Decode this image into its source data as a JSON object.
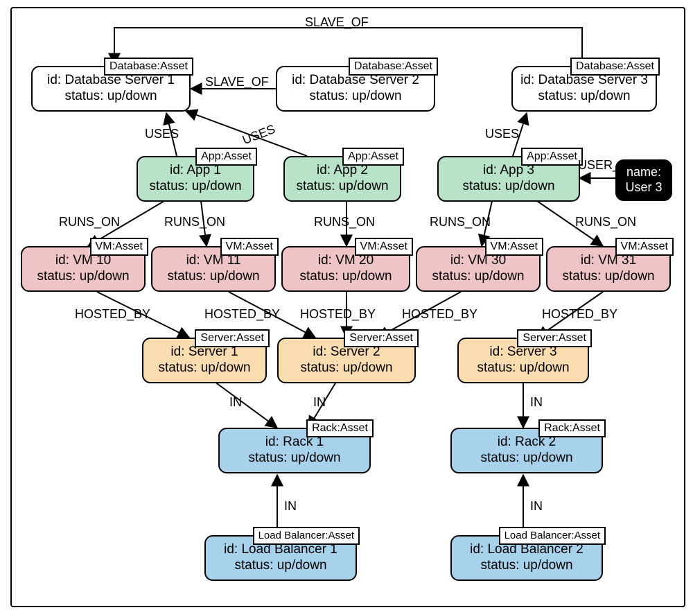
{
  "colors": {
    "db": "#ffffff",
    "app": "#b8e3c8",
    "vm": "#eec4c6",
    "server": "#f9dcb0",
    "rack": "#a8d1ec",
    "lb": "#a8d1ec",
    "user": "#000000"
  },
  "nodes": {
    "db1": {
      "type": "Database:Asset",
      "id": "Database Server 1",
      "status": "up/down"
    },
    "db2": {
      "type": "Database:Asset",
      "id": "Database Server 2",
      "status": "up/down"
    },
    "db3": {
      "type": "Database:Asset",
      "id": "Database Server 3",
      "status": "up/down"
    },
    "app1": {
      "type": "App:Asset",
      "id": "App 1",
      "status": "up/down"
    },
    "app2": {
      "type": "App:Asset",
      "id": "App 2",
      "status": "up/down"
    },
    "app3": {
      "type": "App:Asset",
      "id": "App 3",
      "status": "up/down"
    },
    "user3": {
      "name": "User 3"
    },
    "vm10": {
      "type": "VM:Asset",
      "id": "VM 10",
      "status": "up/down"
    },
    "vm11": {
      "type": "VM:Asset",
      "id": "VM 11",
      "status": "up/down"
    },
    "vm20": {
      "type": "VM:Asset",
      "id": "VM 20",
      "status": "up/down"
    },
    "vm30": {
      "type": "VM:Asset",
      "id": "VM 30",
      "status": "up/down"
    },
    "vm31": {
      "type": "VM:Asset",
      "id": "VM 31",
      "status": "up/down"
    },
    "srv1": {
      "type": "Server:Asset",
      "id": "Server 1",
      "status": "up/down"
    },
    "srv2": {
      "type": "Server:Asset",
      "id": "Server 2",
      "status": "up/down"
    },
    "srv3": {
      "type": "Server:Asset",
      "id": "Server 3",
      "status": "up/down"
    },
    "rack1": {
      "type": "Rack:Asset",
      "id": "Rack 1",
      "status": "up/down"
    },
    "rack2": {
      "type": "Rack:Asset",
      "id": "Rack 2",
      "status": "up/down"
    },
    "lb1": {
      "type": "Load Balancer:Asset",
      "id": "Load Balancer 1",
      "status": "up/down"
    },
    "lb2": {
      "type": "Load Balancer:Asset",
      "id": "Load Balancer 2",
      "status": "up/down"
    }
  },
  "labels": {
    "id_prefix": "id: ",
    "status_prefix": "status: ",
    "name_prefix": "name:"
  },
  "edges": {
    "slave_top": "SLAVE_OF",
    "slave_mid": "SLAVE_OF",
    "uses": "USES",
    "user_of": "USER_OF",
    "runs_on": "RUNS_ON",
    "hosted_by": "HOSTED_BY",
    "in": "IN"
  },
  "relationships": [
    {
      "from": "db2",
      "to": "db1",
      "label": "SLAVE_OF"
    },
    {
      "from": "db3",
      "to": "db1",
      "label": "SLAVE_OF"
    },
    {
      "from": "app1",
      "to": "db1",
      "label": "USES"
    },
    {
      "from": "app2",
      "to": "db1",
      "label": "USES"
    },
    {
      "from": "app3",
      "to": "db3",
      "label": "USES"
    },
    {
      "from": "user3",
      "to": "app3",
      "label": "USER_OF"
    },
    {
      "from": "app1",
      "to": "vm10",
      "label": "RUNS_ON"
    },
    {
      "from": "app1",
      "to": "vm11",
      "label": "RUNS_ON"
    },
    {
      "from": "app2",
      "to": "vm20",
      "label": "RUNS_ON"
    },
    {
      "from": "app3",
      "to": "vm30",
      "label": "RUNS_ON"
    },
    {
      "from": "app3",
      "to": "vm31",
      "label": "RUNS_ON"
    },
    {
      "from": "vm10",
      "to": "srv1",
      "label": "HOSTED_BY"
    },
    {
      "from": "vm11",
      "to": "srv2",
      "label": "HOSTED_BY"
    },
    {
      "from": "vm20",
      "to": "srv2",
      "label": "HOSTED_BY"
    },
    {
      "from": "vm30",
      "to": "srv2",
      "label": "HOSTED_BY"
    },
    {
      "from": "vm31",
      "to": "srv3",
      "label": "HOSTED_BY"
    },
    {
      "from": "srv1",
      "to": "rack1",
      "label": "IN"
    },
    {
      "from": "srv2",
      "to": "rack1",
      "label": "IN"
    },
    {
      "from": "srv3",
      "to": "rack2",
      "label": "IN"
    },
    {
      "from": "lb1",
      "to": "rack1",
      "label": "IN"
    },
    {
      "from": "lb2",
      "to": "rack2",
      "label": "IN"
    }
  ]
}
